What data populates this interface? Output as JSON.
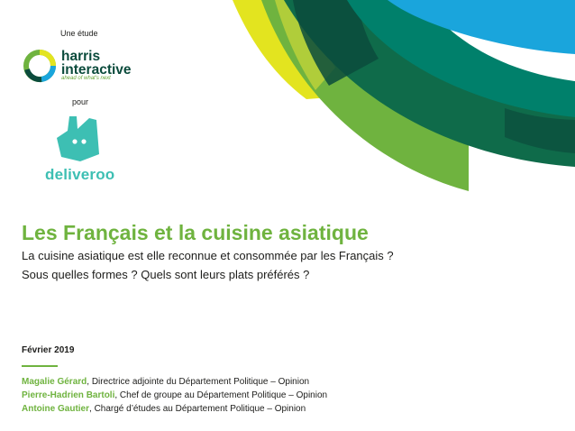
{
  "header": {
    "study_label": "Une étude",
    "for_label": "pour"
  },
  "harris": {
    "name_line1": "harris",
    "name_line2": "interactive",
    "tagline": "ahead of what's next"
  },
  "deliveroo": {
    "name": "deliveroo",
    "color": "#3dbfb3"
  },
  "main": {
    "title": "Les Français et la cuisine asiatique",
    "subtitle_line1": "La cuisine asiatique est elle reconnue et consommée par les Français ?",
    "subtitle_line2": "Sous quelles formes ? Quels sont leurs plats préférés ?"
  },
  "footer": {
    "date": "Février 2019",
    "authors": [
      {
        "name": "Magalie Gérard",
        "role": ", Directrice adjointe du Département Politique – Opinion"
      },
      {
        "name": "Pierre-Hadrien Bartoli",
        "role": ", Chef de groupe au Département Politique – Opinion"
      },
      {
        "name": "Antoine Gautier",
        "role": ", Chargé d’études au Département Politique – Opinion"
      }
    ]
  },
  "colors": {
    "green": "#6fb33f",
    "dark_green": "#0b4b3c",
    "yellow": "#e3e41f",
    "blue": "#1aa5dc",
    "teal": "#00806b"
  }
}
